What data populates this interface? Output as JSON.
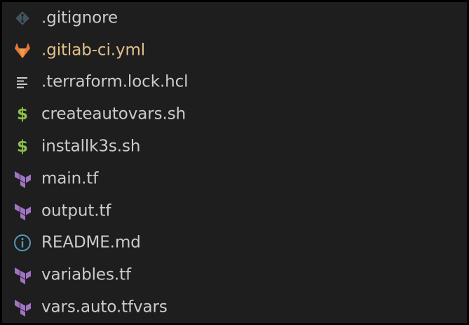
{
  "explorer": {
    "files": [
      {
        "name": ".gitignore",
        "icon": "git-icon",
        "label_color": "#cccccc"
      },
      {
        "name": ".gitlab-ci.yml",
        "icon": "gitlab-icon",
        "label_color": "#e2c08d"
      },
      {
        "name": ".terraform.lock.hcl",
        "icon": "text-lines-icon",
        "label_color": "#cccccc"
      },
      {
        "name": "createautovars.sh",
        "icon": "shell-dollar-icon",
        "label_color": "#cccccc"
      },
      {
        "name": "installk3s.sh",
        "icon": "shell-dollar-icon",
        "label_color": "#cccccc"
      },
      {
        "name": "main.tf",
        "icon": "terraform-icon",
        "label_color": "#cccccc"
      },
      {
        "name": "output.tf",
        "icon": "terraform-icon",
        "label_color": "#cccccc"
      },
      {
        "name": "README.md",
        "icon": "info-icon",
        "label_color": "#cccccc"
      },
      {
        "name": "variables.tf",
        "icon": "terraform-icon",
        "label_color": "#cccccc"
      },
      {
        "name": "vars.auto.tfvars",
        "icon": "terraform-icon",
        "label_color": "#cccccc"
      }
    ],
    "colors": {
      "background": "#1e1e1e",
      "frame": "#000000",
      "text": "#cccccc",
      "modified_text": "#e2c08d",
      "git_icon": "#41535b",
      "gitlab_icon": "#e37933",
      "shell_icon": "#8dc149",
      "terraform_icon": "#a074c4",
      "info_icon": "#519aba",
      "lines_icon": "#cccccc"
    }
  }
}
